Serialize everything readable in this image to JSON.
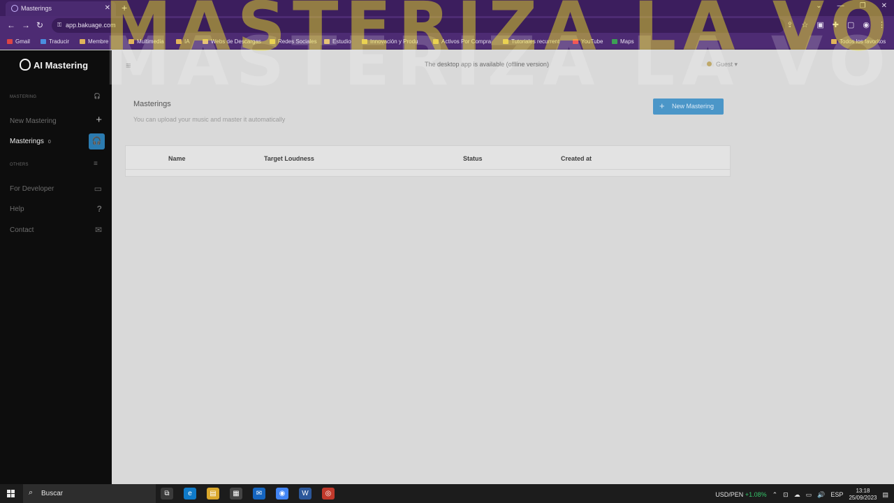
{
  "browser": {
    "tab_title": "Masterings",
    "tab_close": "✕",
    "new_tab": "+",
    "url": "app.bakuage.com",
    "back": "←",
    "forward": "→",
    "reload": "↻",
    "window_controls": [
      "⌄",
      "—",
      "❐",
      "✕"
    ],
    "toolbar_icons": [
      "⇪",
      "☆",
      "▣",
      "✚",
      "▢",
      "◉",
      "⋮"
    ],
    "bookmarks": [
      "Gmail",
      "Traducir",
      "Membre",
      "Multimedia",
      "IA",
      "Webs de Descargas",
      "Redes Sociales",
      "Estudio",
      "Innovación y Produ",
      "Activos Por Compra",
      "Tutoriales recurrent",
      "YouTube",
      "Maps"
    ],
    "all_bookmarks": "Todos los favoritos"
  },
  "sidebar": {
    "logo": "AI Mastering",
    "section_mastering": "MASTERING",
    "new_mastering": "New Mastering",
    "masterings": "Masterings",
    "masterings_count": "0",
    "section_others": "OTHERS",
    "for_developer": "For Developer",
    "help": "Help",
    "contact": "Contact",
    "icons": {
      "headphones": "🎧",
      "plus": "+",
      "list": "≡",
      "monitor": "▭",
      "question": "?",
      "envelope": "✉"
    }
  },
  "header": {
    "menu_icon": "≡",
    "notice": "The desktop app is available (offline version)",
    "user": "Guest ▾"
  },
  "main": {
    "title": "Masterings",
    "subtitle": "You can upload your music and master it automatically",
    "new_button": "New Mastering",
    "new_button_icon": "+",
    "table_columns": [
      "Name",
      "Target Loudness",
      "Status",
      "Created at"
    ]
  },
  "overlay": {
    "text": "MASTERIZA LA VOZ"
  },
  "taskbar": {
    "search": "Buscar",
    "search_icon": "⌕",
    "apps": [
      {
        "label": "⧉",
        "color": "#3a3a3a"
      },
      {
        "label": "e",
        "color": "#0f7ac8"
      },
      {
        "label": "▤",
        "color": "#d9a72b"
      },
      {
        "label": "▦",
        "color": "#444444"
      },
      {
        "label": "✉",
        "color": "#1565c0"
      },
      {
        "label": "◉",
        "color": "#4285f4"
      },
      {
        "label": "W",
        "color": "#2b579a"
      },
      {
        "label": "◎",
        "color": "#c0392b"
      }
    ],
    "ticker": "USD/PEN",
    "ticker_change": "+1.08%",
    "language": "ESP",
    "time": "13:18",
    "date": "25/09/2023",
    "tray_icons": [
      "⌃",
      "⊡",
      "☁",
      "▭",
      "🔊"
    ],
    "notification_icon": "▤"
  },
  "colors": {
    "accent": "#2b7bb0",
    "browser_frame": "#4d2b73",
    "sidebar_bg": "#0d0d0d",
    "overlay_text": "#f0e428"
  }
}
